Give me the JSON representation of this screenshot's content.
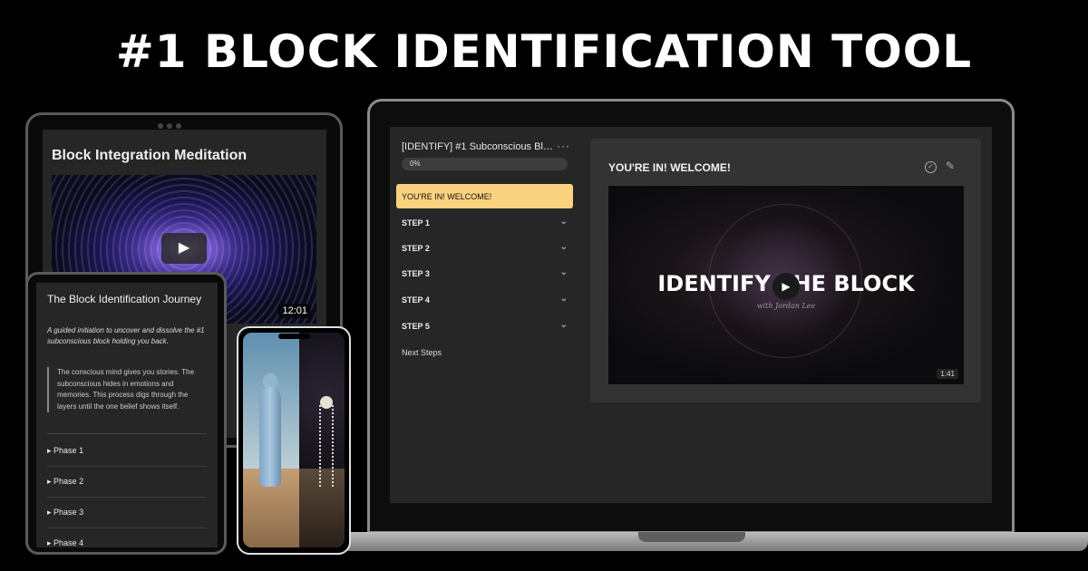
{
  "headline": "#1 BLOCK IDENTIFICATION TOOL",
  "laptop": {
    "course_title": "[IDENTIFY] #1 Subconscious Blo...",
    "more_icon": "more-horizontal-icon",
    "progress_label": "0%",
    "progress_value": 0,
    "active_lesson": "YOU'RE IN! WELCOME!",
    "steps": [
      "STEP 1",
      "STEP 2",
      "STEP 3",
      "STEP 4",
      "STEP 5"
    ],
    "next_steps": "Next Steps",
    "lesson_heading": "YOU'RE IN! WELCOME!",
    "video_title": "IDENTIFY THE BLOCK",
    "video_subtitle": "with Jordan Lee",
    "video_duration": "1:41",
    "accent_color": "#fbd37f"
  },
  "tablet_back": {
    "title": "Block Integration Meditation",
    "video_duration": "12:01"
  },
  "tablet_front": {
    "title": "The Block Identification Journey",
    "subtitle": "A guided initiation to uncover and dissolve the #1 subconscious block holding you back.",
    "quote": "The conscious mind gives you stories. The subconscious hides in emotions and memories. This process digs through the layers until the one belief shows itself.",
    "phases": [
      "Phase 1",
      "Phase 2",
      "Phase 3",
      "Phase 4"
    ]
  },
  "glyphs": {
    "chevron": "⌄",
    "play": "▶",
    "check": "✓",
    "pencil": "✎",
    "caret": "▸",
    "more": "···"
  }
}
